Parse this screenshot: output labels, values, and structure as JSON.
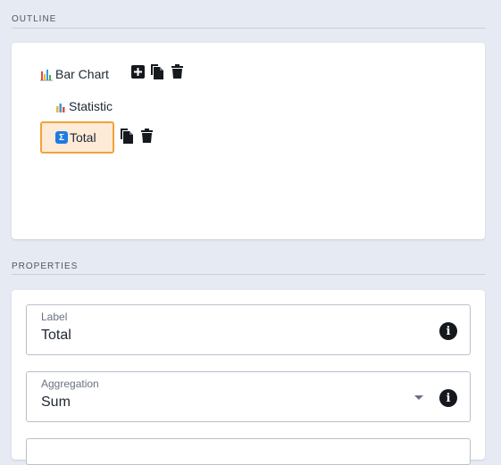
{
  "outline": {
    "section_title": "OUTLINE",
    "root": {
      "label": "Bar Chart",
      "icon": "bar-chart-icon"
    },
    "child": {
      "label": "Statistic",
      "icon": "small-bar-chart-icon"
    },
    "selected": {
      "label": "Total",
      "icon": "sigma-icon",
      "badge": "Σ"
    }
  },
  "properties": {
    "section_title": "PROPERTIES",
    "label_field": {
      "label": "Label",
      "value": "Total"
    },
    "aggregation_field": {
      "label": "Aggregation",
      "value": "Sum"
    },
    "info_glyph": "i"
  },
  "colors": {
    "background": "#e6eaf2",
    "selected_border": "#f0a33a",
    "selected_fill": "#fdebd7",
    "sigma_blue": "#1e7be0"
  }
}
